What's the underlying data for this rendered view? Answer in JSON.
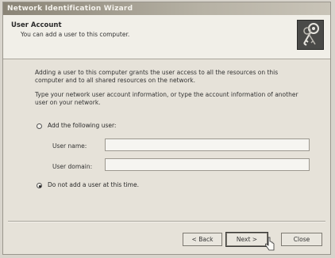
{
  "window": {
    "title": "Network Identification Wizard"
  },
  "header": {
    "title": "User Account",
    "subtitle": "You can add a user to this computer.",
    "icon": "keys-icon"
  },
  "body": {
    "intro": "Adding a user to this computer grants the user access to all the resources on this computer and to all shared resources on the network.",
    "instruction": "Type your network user account information, or type the account information of another user on your network.",
    "option_add": {
      "label": "Add the following user:",
      "selected": false
    },
    "user_name": {
      "label": "User name:",
      "value": ""
    },
    "user_domain": {
      "label": "User domain:",
      "value": ""
    },
    "option_skip": {
      "label": "Do not add a user at this time.",
      "selected": true
    }
  },
  "buttons": {
    "back": "< Back",
    "next": "Next >",
    "close": "Close"
  }
}
